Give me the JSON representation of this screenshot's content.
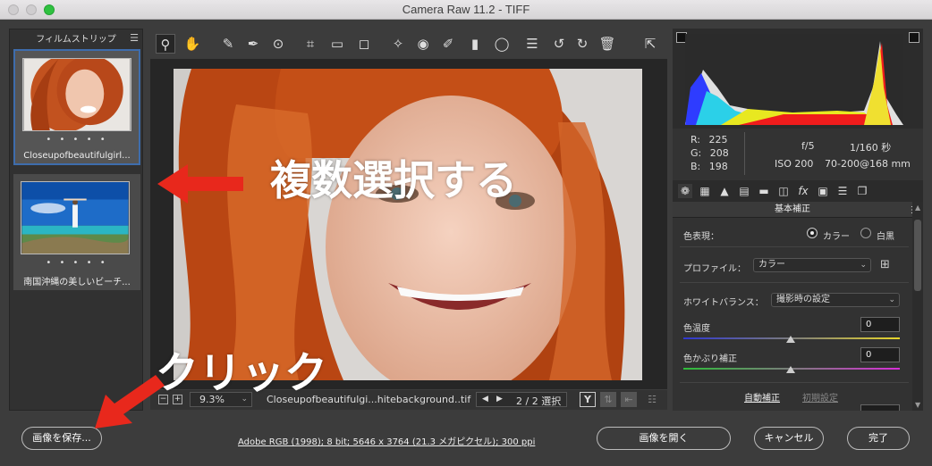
{
  "window": {
    "title": "Camera Raw 11.2  -  TIFF"
  },
  "filmstrip": {
    "title": "フィルムストリップ",
    "items": [
      {
        "name": "Closeupofbeautifulgirl...",
        "rating_dots": "• • • • •"
      },
      {
        "name": "南国沖縄の美しいビーチ...",
        "rating_dots": "• • • • •"
      }
    ]
  },
  "status_bar": {
    "zoom": "9.3%",
    "filename": "Closeupofbeautifulgi...hitebackground..tif",
    "selection": "2 / 2 選択",
    "compare_label": "Y"
  },
  "info": {
    "r_label": "R:",
    "r_value": "225",
    "g_label": "G:",
    "g_value": "208",
    "b_label": "B:",
    "b_value": "198",
    "aperture": "f/5",
    "shutter": "1/160 秒",
    "iso": "ISO 200",
    "lens": "70-200@168 mm"
  },
  "basic_panel": {
    "title": "基本補正",
    "treatment_label": "色表現：",
    "color_option": "カラー",
    "bw_option": "白黒",
    "profile_label": "プロファイル：",
    "profile_value": "カラー",
    "wb_label": "ホワイトバランス：",
    "wb_value": "撮影時の設定",
    "temp_label": "色温度",
    "temp_value": "0",
    "tint_label": "色かぶり補正",
    "tint_value": "0",
    "auto_label": "自動補正",
    "default_label": "初期設定"
  },
  "bottom": {
    "save_button": "画像を保存...",
    "workflow_link": "Adobe RGB (1998); 8 bit; 5646 x 3764 (21.3 メガピクセル); 300 ppi",
    "open_button": "画像を開く",
    "cancel_button": "キャンセル",
    "done_button": "完了"
  },
  "annotations": {
    "multi_select": "複数選択する",
    "click": "クリック"
  },
  "colors": {
    "annotation_red": "#e8281c",
    "selection_blue": "#3e6dad"
  }
}
